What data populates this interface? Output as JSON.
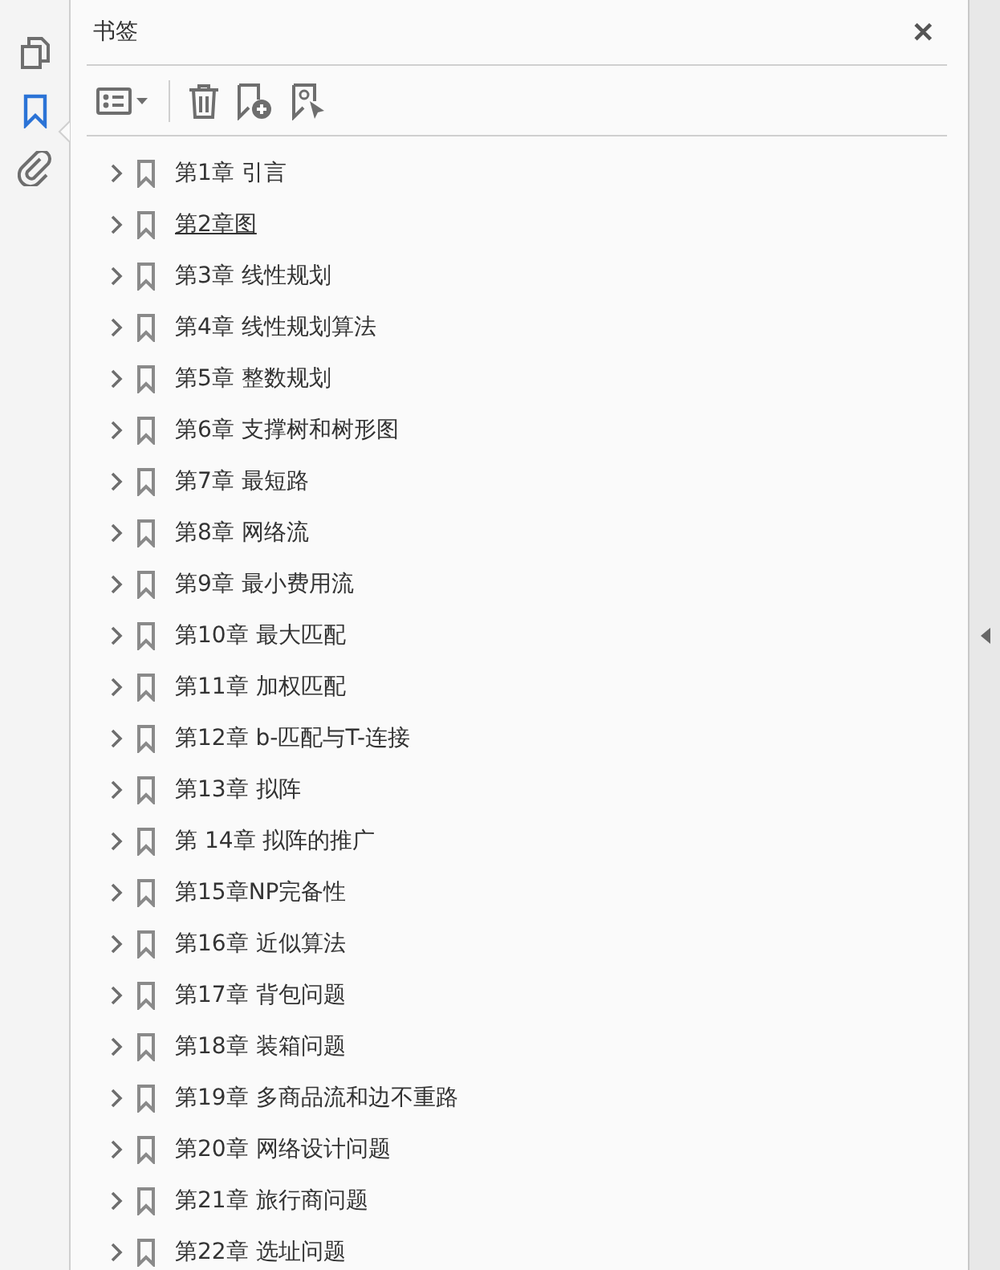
{
  "panel": {
    "title": "书签",
    "close": "✕"
  },
  "bookmarks": [
    {
      "label": "第1章  引言",
      "expanded": false,
      "hovered": false
    },
    {
      "label": "第2章图",
      "expanded": false,
      "hovered": true
    },
    {
      "label": "第3章  线性规划",
      "expanded": false,
      "hovered": false
    },
    {
      "label": "第4章  线性规划算法",
      "expanded": false,
      "hovered": false
    },
    {
      "label": "第5章  整数规划",
      "expanded": false,
      "hovered": false
    },
    {
      "label": "第6章  支撑树和树形图",
      "expanded": false,
      "hovered": false
    },
    {
      "label": "第7章  最短路",
      "expanded": false,
      "hovered": false
    },
    {
      "label": "第8章  网络流",
      "expanded": false,
      "hovered": false
    },
    {
      "label": "第9章  最小费用流",
      "expanded": false,
      "hovered": false
    },
    {
      "label": "第10章  最大匹配",
      "expanded": false,
      "hovered": false
    },
    {
      "label": "第11章  加权匹配",
      "expanded": false,
      "hovered": false
    },
    {
      "label": "第12章  b-匹配与T-连接",
      "expanded": false,
      "hovered": false
    },
    {
      "label": "第13章  拟阵",
      "expanded": false,
      "hovered": false
    },
    {
      "label": "第 14章  拟阵的推广",
      "expanded": false,
      "hovered": false
    },
    {
      "label": "第15章NP完备性",
      "expanded": false,
      "hovered": false
    },
    {
      "label": "第16章  近似算法",
      "expanded": false,
      "hovered": false
    },
    {
      "label": "第17章  背包问题",
      "expanded": false,
      "hovered": false
    },
    {
      "label": "第18章  装箱问题",
      "expanded": false,
      "hovered": false
    },
    {
      "label": "第19章  多商品流和边不重路",
      "expanded": false,
      "hovered": false
    },
    {
      "label": "第20章  网络设计问题",
      "expanded": false,
      "hovered": false
    },
    {
      "label": "第21章  旅行商问题",
      "expanded": false,
      "hovered": false
    },
    {
      "label": "第22章  选址问题",
      "expanded": false,
      "hovered": false
    }
  ]
}
